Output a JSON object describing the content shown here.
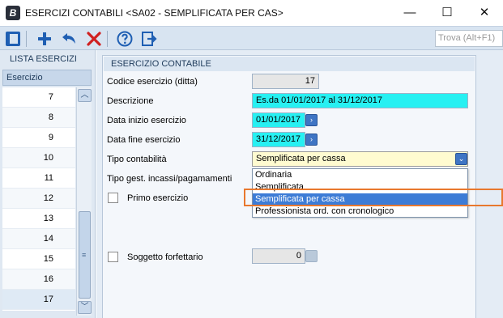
{
  "window": {
    "title": "ESERCIZI CONTABILI <SA02 - SEMPLIFICATA PER CAS>",
    "app_icon_letter": "B",
    "min_glyph": "—",
    "max_glyph": "☐",
    "close_glyph": "✕"
  },
  "toolbar": {
    "buttons": [
      {
        "name": "panel-toggle",
        "icon": "sidebar-icon"
      },
      {
        "name": "add",
        "icon": "plus-icon"
      },
      {
        "name": "undo",
        "icon": "undo-icon"
      },
      {
        "name": "delete",
        "icon": "x-icon"
      },
      {
        "name": "help",
        "icon": "help-icon"
      },
      {
        "name": "exit",
        "icon": "exit-icon"
      }
    ],
    "search_placeholder": "Trova (Alt+F1)",
    "accent_color": "#1f5fb3",
    "delete_color": "#d02020"
  },
  "left_panel": {
    "header": "LISTA ESERCIZI",
    "column": "Esercizio",
    "rows": [
      "7",
      "8",
      "9",
      "10",
      "11",
      "12",
      "13",
      "14",
      "15",
      "16",
      "17"
    ]
  },
  "form": {
    "group_title": "ESERCIZIO CONTABILE",
    "codice_label": "Codice esercizio (ditta)",
    "codice_value": "17",
    "descrizione_label": "Descrizione",
    "descrizione_value": "Es.da 01/01/2017 al 31/12/2017",
    "data_inizio_label": "Data inizio esercizio",
    "data_inizio_value": "01/01/2017",
    "data_fine_label": "Data fine esercizio",
    "data_fine_value": "31/12/2017",
    "tipo_contabilita_label": "Tipo contabilità",
    "tipo_contabilita_value": "Semplificata per cassa",
    "tipo_gest_label": "Tipo gest. incassi/pagamamenti",
    "primo_esercizio_label": "Primo esercizio",
    "soggetto_label": "Soggetto forfettario",
    "soggetto_value": "0"
  },
  "dropdown": {
    "options": [
      "Ordinaria",
      "Semplificata",
      "Semplificata per cassa",
      "Professionista ord. con cronologico"
    ],
    "selected_index": 2
  },
  "colors": {
    "cyan_field": "#27f0f2",
    "yellow_field": "#fffbd0",
    "highlight": "#e8782e",
    "selection": "#3d7cd6"
  }
}
